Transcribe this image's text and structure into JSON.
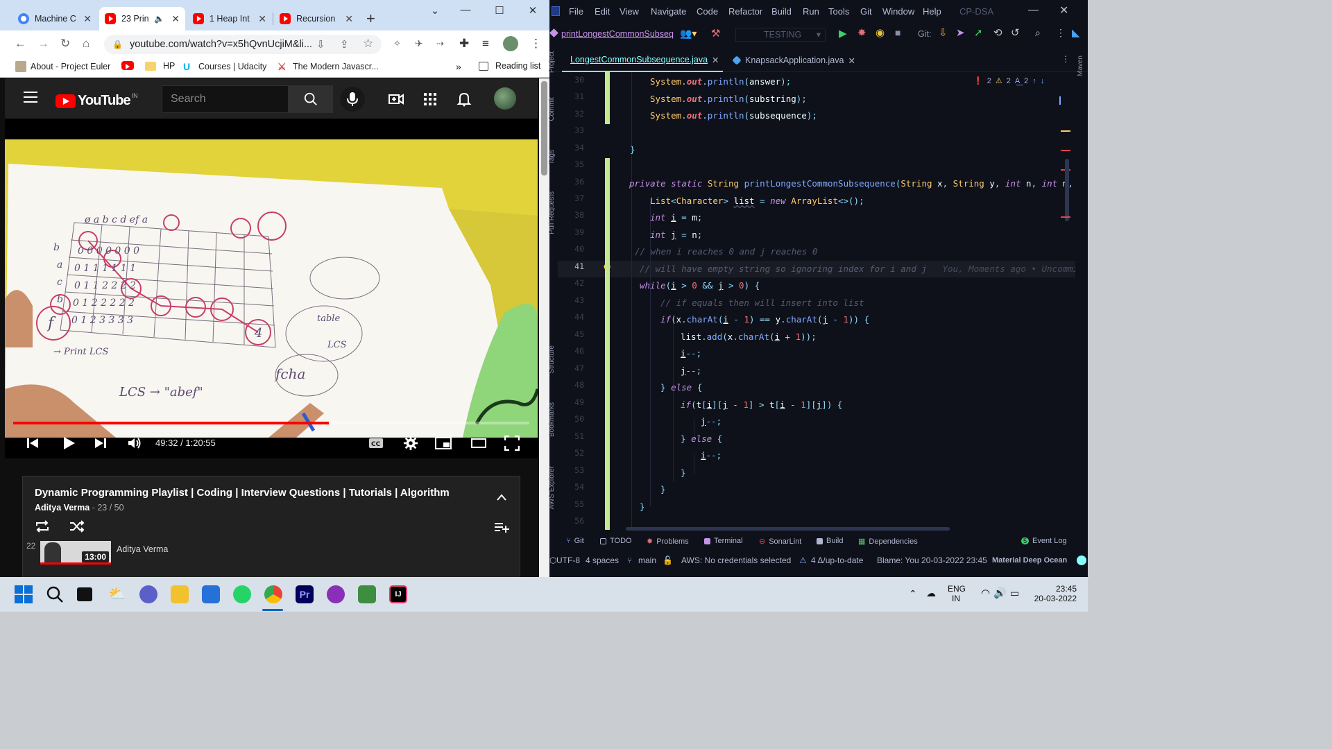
{
  "chrome": {
    "tabs": [
      {
        "title": "Machine C",
        "icon": "chrome-icon",
        "active": false
      },
      {
        "title": "23 Prin",
        "icon": "youtube-icon",
        "active": true,
        "audio": true
      },
      {
        "title": "1 Heap Int",
        "icon": "youtube-icon",
        "active": false
      },
      {
        "title": "Recursion",
        "icon": "youtube-icon",
        "active": false
      }
    ],
    "new_tab": "+",
    "url": "youtube.com/watch?v=x5hQvnUcjiM&li...",
    "bookmarks": [
      {
        "label": "About - Project Euler",
        "icon": "euler-icon"
      },
      {
        "label": "",
        "icon": "youtube-icon"
      },
      {
        "label": "HP",
        "icon": "folder-icon"
      },
      {
        "label": "Courses | Udacity",
        "icon": "udacity-icon"
      },
      {
        "label": "The Modern Javascr...",
        "icon": "js-icon"
      }
    ],
    "more_bookmarks": "»",
    "reading_list": "Reading list"
  },
  "youtube": {
    "logo_text": "YouTube",
    "region": "IN",
    "search_placeholder": "Search",
    "player": {
      "time": "49:32 / 1:20:55",
      "progress": 0.612,
      "buffered": 0.618
    },
    "playlist": {
      "title": "Dynamic Programming Playlist | Coding | Interview Questions | Tutorials | Algorithm",
      "author": "Aditya Verma",
      "position": "- 23 / 50",
      "item_index": "22",
      "item_duration": "13:00",
      "item_author": "Aditya Verma"
    }
  },
  "ide": {
    "menu": [
      "File",
      "Edit",
      "View",
      "Navigate",
      "Code",
      "Refactor",
      "Build",
      "Run",
      "Tools",
      "Git",
      "Window",
      "Help",
      "CP-DSA"
    ],
    "breadcrumb": "printLongestCommonSubseq",
    "run_config": "TESTING",
    "git_label": "Git:",
    "tabs": [
      {
        "label": "LongestCommonSubsequence.java",
        "active": true
      },
      {
        "label": "KnapsackApplication.java",
        "active": false
      }
    ],
    "inspections": {
      "errors": "2",
      "warnings": "2",
      "typos": "2"
    },
    "side_tools": [
      "Project",
      "Commit",
      "Tags",
      "Pull Requests",
      "Structure",
      "Bookmarks",
      "AWS Explorer"
    ],
    "right_tools": [
      "Maven"
    ],
    "line_numbers": [
      "30",
      "31",
      "32",
      "33",
      "34",
      "35",
      "36",
      "37",
      "38",
      "39",
      "40",
      "41",
      "42",
      "43",
      "44",
      "45",
      "46",
      "47",
      "48",
      "49",
      "50",
      "51",
      "52",
      "53",
      "54",
      "55",
      "56"
    ],
    "blame": "You, Moments ago • Uncommi",
    "bottom_tools": [
      "Git",
      "TODO",
      "Problems",
      "Terminal",
      "SonarLint",
      "Build",
      "Dependencies",
      "Event Log"
    ],
    "event_log_count": "5",
    "status": {
      "encoding": "UTF-8",
      "indent": "4 spaces",
      "branch": "main",
      "aws": "AWS: No credentials selected",
      "updates": "4 Δ/up-to-date",
      "blame": "Blame: You 20-03-2022 23:45",
      "theme": "Material Deep Ocean"
    }
  },
  "taskbar": {
    "lang": "ENG",
    "region": "IN",
    "time": "23:45",
    "date": "20-03-2022"
  }
}
